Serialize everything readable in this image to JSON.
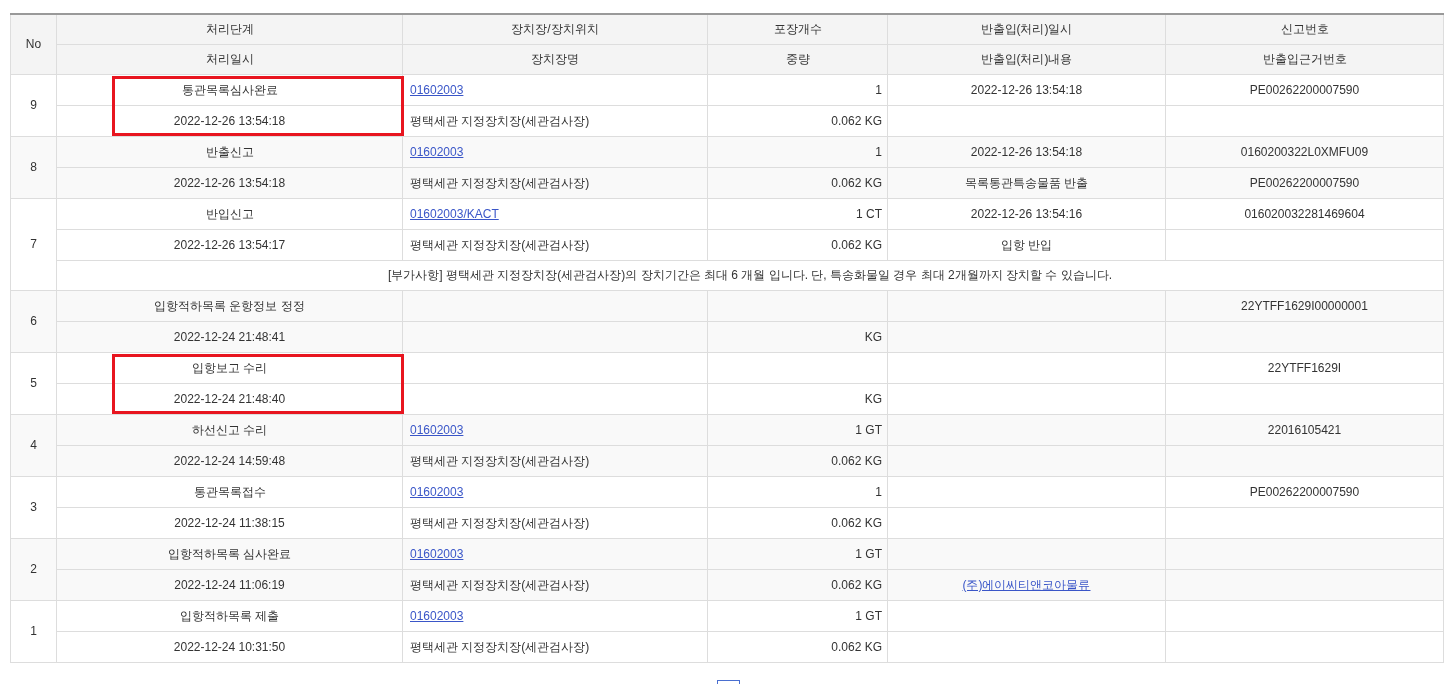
{
  "table": {
    "columns_top": [
      "No",
      "처리단계",
      "장치장/장치위치",
      "포장개수",
      "반출입(처리)일시",
      "신고번호"
    ],
    "columns_bottom": [
      "처리일시",
      "장치장명",
      "중량",
      "반출입(처리)내용",
      "반출입근거번호"
    ],
    "rows": [
      {
        "no": "9",
        "step": "통관목록심사완료",
        "processed_at": "2022-12-26 13:54:18",
        "storage_code": "01602003",
        "storage_name": "평택세관 지정장치장(세관검사장)",
        "packages": "1",
        "weight": "0.062 KG",
        "io_datetime": "2022-12-26 13:54:18",
        "report_no": "PE00262200007590",
        "highlighted": true
      },
      {
        "no": "8",
        "step": "반출신고",
        "processed_at": "2022-12-26 13:54:18",
        "storage_code": "01602003",
        "storage_name": "평택세관 지정장치장(세관검사장)",
        "packages": "1",
        "weight": "0.062 KG",
        "io_datetime": "2022-12-26 13:54:18",
        "io_content": {
          "text": "목록통관특송물품 반출",
          "link": false
        },
        "report_no": "0160200322L0XMFU09",
        "basis_no": "PE00262200007590",
        "highlighted": false
      },
      {
        "no": "7",
        "step": "반입신고",
        "processed_at": "2022-12-26 13:54:17",
        "storage_code": "01602003/KACT",
        "storage_name": "평택세관 지정장치장(세관검사장)",
        "packages": "1 CT",
        "weight": "0.062 KG",
        "io_datetime": "2022-12-26 13:54:16",
        "io_content": {
          "text": "입항 반입",
          "link": false
        },
        "report_no": "016020032281469604",
        "note": "[부가사항] 평택세관 지정장치장(세관검사장)의 장치기간은 최대 6 개월 입니다. 단, 특송화물일 경우 최대 2개월까지 장치할 수 있습니다.",
        "highlighted": false
      },
      {
        "no": "6",
        "step": "입항적하목록 운항정보 정정",
        "processed_at": "2022-12-24 21:48:41",
        "weight": "KG",
        "report_no": "22YTFF1629I00000001",
        "highlighted": false
      },
      {
        "no": "5",
        "step": "입항보고 수리",
        "processed_at": "2022-12-24 21:48:40",
        "weight": "KG",
        "report_no": "22YTFF1629I",
        "highlighted": true
      },
      {
        "no": "4",
        "step": "하선신고 수리",
        "processed_at": "2022-12-24 14:59:48",
        "storage_code": "01602003",
        "storage_name": "평택세관 지정장치장(세관검사장)",
        "packages": "1 GT",
        "weight": "0.062 KG",
        "report_no": "22016105421",
        "highlighted": false
      },
      {
        "no": "3",
        "step": "통관목록접수",
        "processed_at": "2022-12-24 11:38:15",
        "storage_code": "01602003",
        "storage_name": "평택세관 지정장치장(세관검사장)",
        "packages": "1",
        "weight": "0.062 KG",
        "report_no": "PE00262200007590",
        "highlighted": false
      },
      {
        "no": "2",
        "step": "입항적하목록 심사완료",
        "processed_at": "2022-12-24 11:06:19",
        "storage_code": "01602003",
        "storage_name": "평택세관 지정장치장(세관검사장)",
        "packages": "1 GT",
        "weight": "0.062 KG",
        "io_content": {
          "text": "(주)에이씨티앤코아물류",
          "link": true
        },
        "highlighted": false
      },
      {
        "no": "1",
        "step": "입항적하목록 제출",
        "processed_at": "2022-12-24 10:31:50",
        "storage_code": "01602003",
        "storage_name": "평택세관 지정장치장(세관검사장)",
        "packages": "1 GT",
        "weight": "0.062 KG",
        "highlighted": false
      }
    ]
  }
}
